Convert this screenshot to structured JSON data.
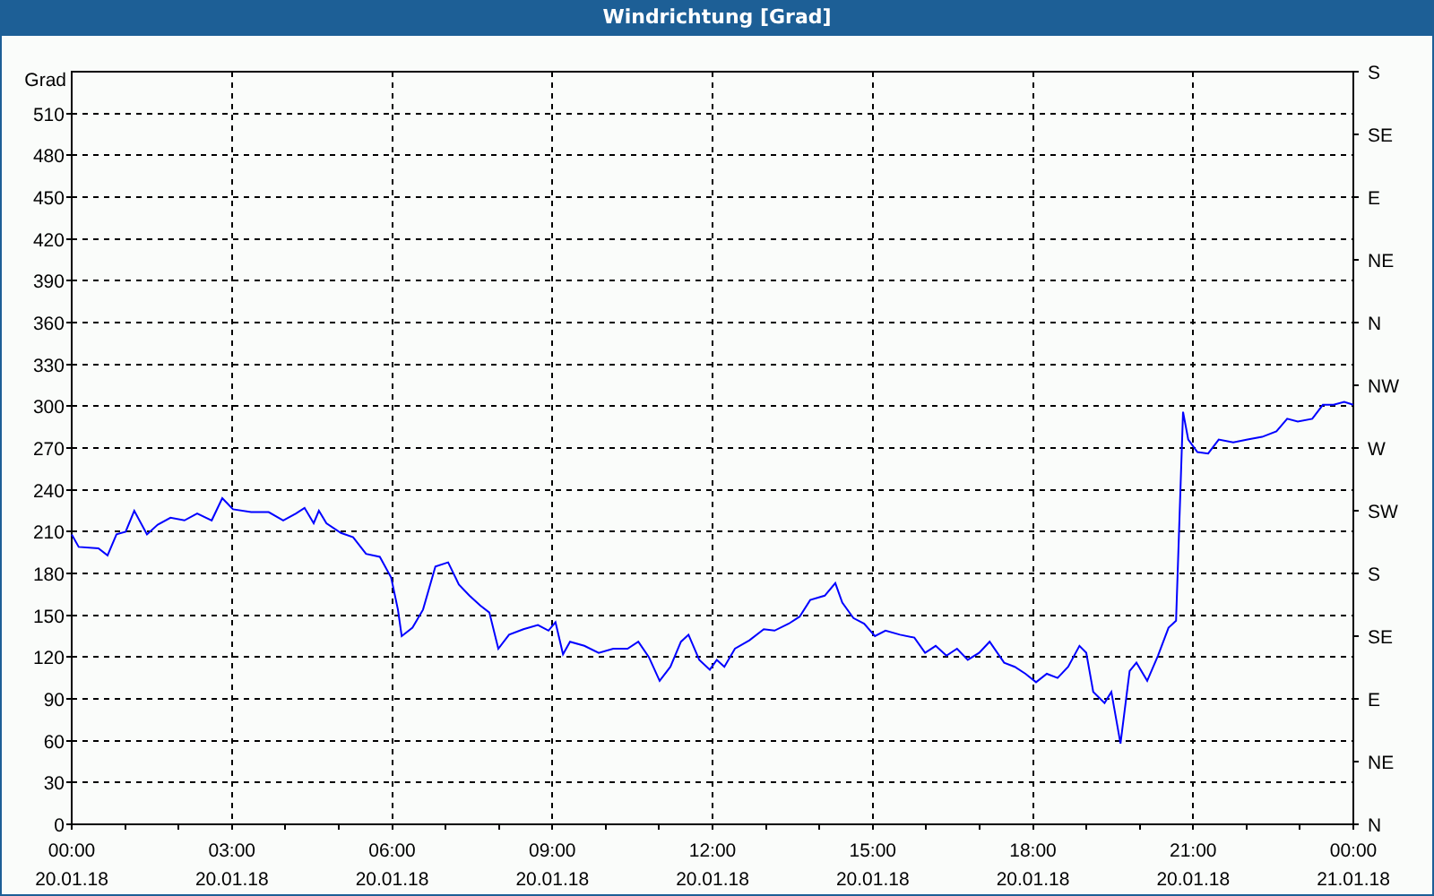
{
  "window": {
    "title": "Windrichtung [Grad]"
  },
  "chart": {
    "chart_data": {
      "type": "line",
      "grid": true,
      "ylabel": "Grad",
      "xlim": [
        0,
        24
      ],
      "ylim": [
        0,
        540
      ],
      "xticks": [
        {
          "value": 0,
          "label": "00:00"
        },
        {
          "value": 3,
          "label": "03:00"
        },
        {
          "value": 6,
          "label": "06:00"
        },
        {
          "value": 9,
          "label": "09:00"
        },
        {
          "value": 12,
          "label": "12:00"
        },
        {
          "value": 15,
          "label": "15:00"
        },
        {
          "value": 18,
          "label": "18:00"
        },
        {
          "value": 21,
          "label": "21:00"
        },
        {
          "value": 24,
          "label": "00:00"
        }
      ],
      "yticks": [
        0,
        30,
        60,
        90,
        120,
        150,
        180,
        210,
        240,
        270,
        300,
        330,
        360,
        390,
        420,
        450,
        480,
        510
      ],
      "x": [
        0,
        0.13,
        0.5,
        0.67,
        0.84,
        1.01,
        1.17,
        1.41,
        1.61,
        1.85,
        2.11,
        2.35,
        2.62,
        2.82,
        3.02,
        3.36,
        3.69,
        3.96,
        4.2,
        4.36,
        4.53,
        4.63,
        4.77,
        5.04,
        5.27,
        5.51,
        5.77,
        5.98,
        6.11,
        6.18,
        6.38,
        6.58,
        6.81,
        7.05,
        7.25,
        7.45,
        7.65,
        7.82,
        7.99,
        8.19,
        8.46,
        8.73,
        8.93,
        9.06,
        9.2,
        9.33,
        9.6,
        9.87,
        10.14,
        10.41,
        10.61,
        10.81,
        11.01,
        11.21,
        11.41,
        11.55,
        11.75,
        11.95,
        12.08,
        12.22,
        12.42,
        12.69,
        12.96,
        13.16,
        13.43,
        13.63,
        13.83,
        14.1,
        14.3,
        14.43,
        14.64,
        14.84,
        15.04,
        15.24,
        15.51,
        15.78,
        15.98,
        16.18,
        16.38,
        16.58,
        16.78,
        16.99,
        17.19,
        17.46,
        17.66,
        17.86,
        18.06,
        18.26,
        18.46,
        18.66,
        18.87,
        19,
        19.13,
        19.34,
        19.47,
        19.64,
        19.81,
        19.94,
        20.14,
        20.34,
        20.54,
        20.68,
        20.81,
        20.91,
        21.08,
        21.28,
        21.48,
        21.75,
        22.02,
        22.29,
        22.56,
        22.76,
        22.96,
        23.23,
        23.43,
        23.63,
        23.83,
        24
      ],
      "series": [
        {
          "color": "#0000ff",
          "values": [
            208,
            199,
            198,
            193,
            208,
            210,
            225,
            208,
            215,
            220,
            218,
            223,
            218,
            234,
            226,
            224,
            224,
            218,
            223,
            227,
            216,
            225,
            216,
            209,
            206,
            194,
            192,
            177,
            154,
            135,
            141,
            154,
            185,
            188,
            172,
            164,
            157,
            152,
            126,
            136,
            140,
            143,
            139,
            145,
            122,
            131,
            128,
            123,
            126,
            126,
            131,
            120,
            103,
            113,
            131,
            136,
            118,
            111,
            118,
            113,
            126,
            132,
            140,
            139,
            144,
            149,
            161,
            164,
            173,
            159,
            148,
            144,
            135,
            139,
            136,
            134,
            123,
            128,
            121,
            126,
            118,
            123,
            131,
            116,
            113,
            108,
            102,
            108,
            105,
            113,
            128,
            123,
            95,
            87,
            95,
            58,
            110,
            116,
            103,
            121,
            141,
            146,
            296,
            276,
            267,
            266,
            276,
            274,
            276,
            278,
            282,
            291,
            289,
            291,
            301,
            301,
            303,
            301
          ]
        }
      ]
    },
    "compass_labels": [
      "S",
      "SE",
      "E",
      "NE",
      "N",
      "NW",
      "W",
      "SW",
      "S",
      "SE",
      "E",
      "NE",
      "N"
    ],
    "date_labels": [
      "20.01.18",
      "20.01.18",
      "20.01.18",
      "20.01.18",
      "20.01.18",
      "20.01.18",
      "20.01.18",
      "20.01.18",
      "21.01.18"
    ]
  }
}
